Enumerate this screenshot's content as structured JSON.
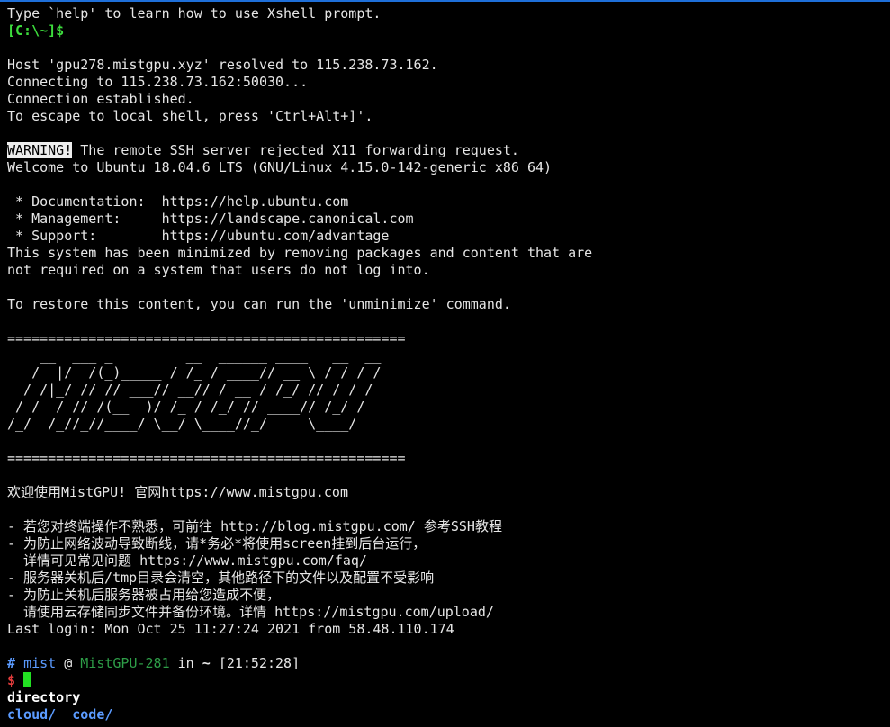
{
  "colors": {
    "text": "#e6e6e6",
    "local_prompt": "#3ddc3d",
    "prompt_hash": "#5b9bff",
    "prompt_user": "#5b9bff",
    "prompt_host": "#2e9e48",
    "prompt_plain": "#e6e6e6",
    "prompt_symbol": "#e23c3c",
    "cursor": "#22e022",
    "dir_heading": "#ffffff",
    "dirs": "#5b9bff",
    "window_accent": "#1e6fd9"
  },
  "session": {
    "xshell_hint": "Type `help' to learn how to use Xshell prompt.",
    "local_prompt": "[C:\\~]$",
    "host_resolved": "Host 'gpu278.mistgpu.xyz' resolved to 115.238.73.162.",
    "connecting": "Connecting to 115.238.73.162:50030...",
    "established": "Connection established.",
    "escape_hint": "To escape to local shell, press 'Ctrl+Alt+]'."
  },
  "motd": {
    "warning_tag": "WARNING!",
    "warning_text": " The remote SSH server rejected X11 forwarding request.",
    "welcome": "Welcome to Ubuntu 18.04.6 LTS (GNU/Linux 4.15.0-142-generic x86_64)",
    "links": [
      " * Documentation:  https://help.ubuntu.com",
      " * Management:     https://landscape.canonical.com",
      " * Support:        https://ubuntu.com/advantage"
    ],
    "minimized": [
      "This system has been minimized by removing packages and content that are",
      "not required on a system that users do not log into."
    ],
    "restore": "To restore this content, you can run the 'unminimize' command.",
    "rule": "=================================================",
    "banner_art": [
      "    __  ___ _         __  ______ ____   __  __",
      "   /  |/  /(_)_____ / /_ / ____// __ \\ / / / /",
      "  / /|_/ // // ___// __// / __ / /_/ // / / /",
      " / /  / // /(__  )/ /_ / /_/ // ____// /_/ /",
      "/_/  /_//_//____/ \\__/ \\____//_/     \\____/"
    ],
    "greeting": "欢迎使用MistGPU! 官网https://www.mistgpu.com",
    "notes": [
      "- 若您对终端操作不熟悉，可前往 http://blog.mistgpu.com/ 参考SSH教程",
      "- 为防止网络波动导致断线，请*务必*将使用screen挂到后台运行，",
      "  详情可见常见问题 https://www.mistgpu.com/faq/",
      "- 服务器关机后/tmp目录会清空，其他路径下的文件以及配置不受影响",
      "- 为防止关机后服务器被占用给您造成不便，",
      "  请使用云存储同步文件并备份环境。详情 https://mistgpu.com/upload/"
    ],
    "last_login": "Last login: Mon Oct 25 11:27:24 2021 from 58.48.110.174"
  },
  "prompt": {
    "hash": "#",
    "user": "mist",
    "at": "@",
    "host": "MistGPU-281",
    "in": "in",
    "cwd": "~",
    "time": "[21:52:28]",
    "symbol": "$"
  },
  "output": {
    "heading": "directory",
    "dirs": [
      "cloud/",
      "code/"
    ]
  }
}
